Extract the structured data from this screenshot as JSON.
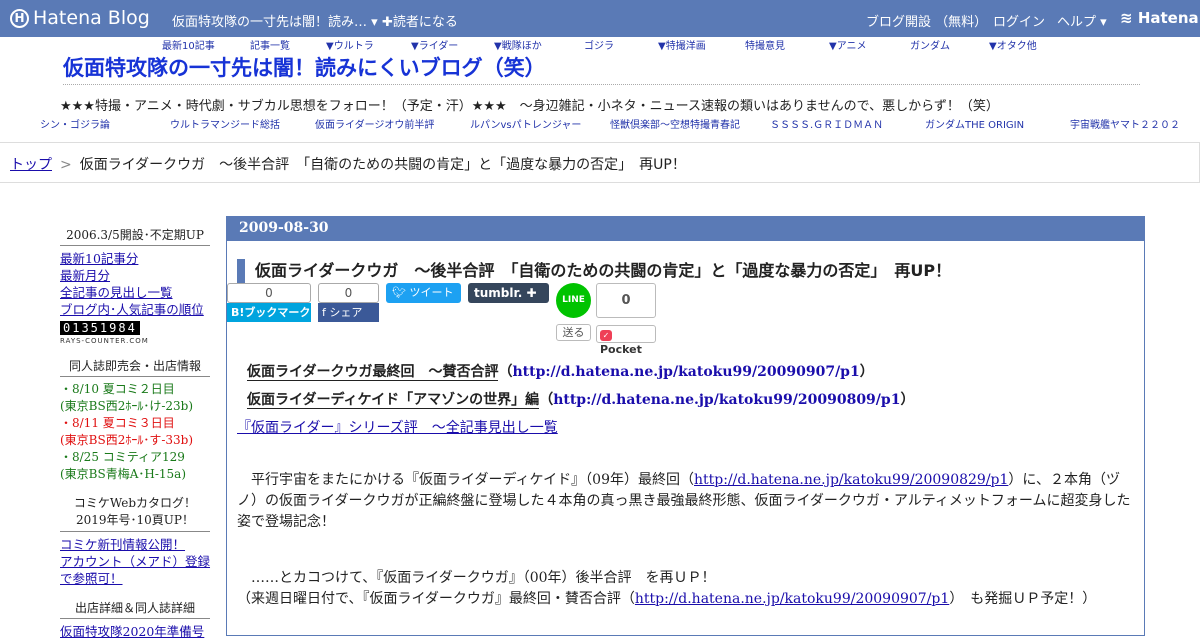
{
  "topbar": {
    "logo": "Hatena Blog",
    "blog_title": "仮面特攻隊の一寸先は闇！読み…",
    "subscribe": "読者になる",
    "open_blog": "ブログ開設 （無料）",
    "login": "ログイン",
    "help": "ヘルプ",
    "brand": "Hatena"
  },
  "nav_top": [
    "最新10記事",
    "記事一覧",
    "▼ウルトラ",
    "▼ライダー",
    "▼戦隊ほか",
    "ゴジラ",
    "▼特撮洋画",
    "特撮意見",
    "▼アニメ",
    "ガンダム",
    "▼オタク他"
  ],
  "blog_heading": "仮面特攻隊の一寸先は闇！読みにくいブログ（笑）",
  "tagline": "★★★特撮・アニメ・時代劇・サブカル思想をフォロー！（予定・汗）★★★　～身辺雑記・小ネタ・ニュース速報の類いはありませんので、悪しからず！（笑）",
  "nav_bottom": [
    "シン・ゴジラ論",
    "ウルトラマンジード総括",
    "仮面ライダージオウ前半評",
    "ルパンvsパトレンジャー",
    "怪獣倶楽部～空想特撮青春記",
    "ＳＳＳＳ.ＧＲＩＤＭＡＮ",
    "ガンダムTHE ORIGIN",
    "宇宙戦艦ヤマト２２０２"
  ],
  "breadcrumb": {
    "home": "トップ",
    "sep": ">",
    "current": "仮面ライダークウガ　〜後半合評　「自衛のための共闘の肯定」と「過度な暴力の否定」　再UP！"
  },
  "sidebar": {
    "section1_title": "2006.3/5開設･不定期UP",
    "links1": [
      "最新10記事分",
      "最新月分",
      "全記事の見出し一覧",
      "ブログ内･人気記事の順位"
    ],
    "counter": "01351984",
    "counter_sub": "RAYS-COUNTER.COM",
    "section2_title": "同人誌即売会・出店情報",
    "events": [
      {
        "line1": "・8/10 夏コミ２日目",
        "line2": "(東京BS西2ﾎｰﾙ･け-23b)",
        "color": "green"
      },
      {
        "line1": "・8/11 夏コミ３日目",
        "line2": "(東京BS西2ﾎｰﾙ･す-33b)",
        "color": "red"
      },
      {
        "line1": "・8/25 コミティア129",
        "line2": "(東京BS青梅A･H-15a)",
        "color": "green"
      }
    ],
    "section3_title": "コミケWebカタログ！2019年号･10頁UP！",
    "links3": [
      "コミケ新刊情報公開！",
      "アカウント（メアド）登録で参照可！"
    ],
    "section4_title": "出店詳細＆同人誌詳細",
    "links4": [
      "仮面特攻隊2020年準備号"
    ]
  },
  "article": {
    "date": "2009-08-30",
    "title": "仮面ライダークウガ　〜後半合評　「自衛のための共闘の肯定」と「過度な暴力の否定」　再UP！",
    "share": {
      "hatena_count": "0",
      "hatena_label": "B!ブックマーク",
      "fb_count": "0",
      "fb_label": "シェア",
      "tweet_label": "ツイート",
      "tumblr_label": "tumblr.",
      "line_label": "LINE",
      "line_send": "送る",
      "pocket_count": "0",
      "pocket_label": "Pocket"
    },
    "ref1_text": "仮面ライダークウガ最終回　〜賛否合評",
    "ref1_link": "http://d.hatena.ne.jp/katoku99/20090907/p1",
    "ref2_text": "仮面ライダーディケイド「アマゾンの世界」編",
    "ref2_link": "http://d.hatena.ne.jp/katoku99/20090809/p1",
    "series_link": "『仮面ライダー』シリーズ評　〜全記事見出し一覧",
    "para1_a": "　平行宇宙をまたにかける『仮面ライダーディケイド』（09年）最終回（",
    "para1_link": "http://d.hatena.ne.jp/katoku99/20090829/p1",
    "para1_b": "）に、２本角（ヅノ）の仮面ライダークウガが正編終盤に登場した４本角の真っ黒き最強最終形態、仮面ライダークウガ・アルティメットフォームに超変身した姿で登場記念！",
    "para2_a": "　……とカコつけて、『仮面ライダークウガ』（00年）後半合評　を再ＵＰ！",
    "para2_b": "（来週日曜日付で、『仮面ライダークウガ』最終回・賛否合評（",
    "para2_link": "http://d.hatena.ne.jp/katoku99/20090907/p1",
    "para2_c": "）　も発掘ＵＰ予定！）"
  }
}
